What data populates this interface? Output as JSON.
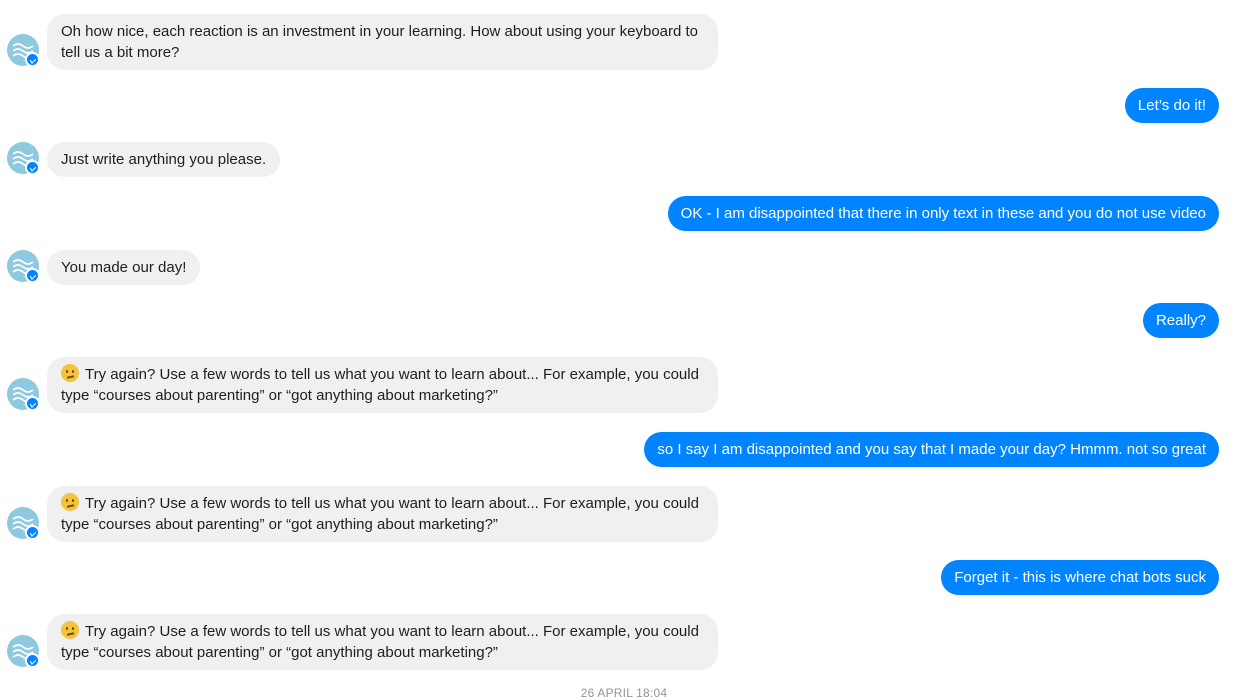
{
  "messages": [
    {
      "from": "bot",
      "text": "Oh how nice, each reaction is an investment in your learning. How about using your keyboard to tell us a bit more?"
    },
    {
      "from": "user",
      "text": "Let’s do it!"
    },
    {
      "from": "bot",
      "text": "Just write anything you please."
    },
    {
      "from": "user",
      "text": "OK - I am disappointed that there in only text in these and you do not use video"
    },
    {
      "from": "bot",
      "text": "You made our day!"
    },
    {
      "from": "user",
      "text": "Really?"
    },
    {
      "from": "bot",
      "emoji": "confused-face",
      "text": "Try again? Use a few words to tell us what you want to learn about... For example, you could type “courses about parenting” or “got anything about marketing?”"
    },
    {
      "from": "user",
      "text": "so I say I am disappointed and you say that I made your day?  Hmmm. not so great"
    },
    {
      "from": "bot",
      "emoji": "confused-face",
      "text": "Try again? Use a few words to tell us what you want to learn about... For example, you could type “courses about parenting” or “got anything about marketing?”"
    },
    {
      "from": "user",
      "text": "Forget it - this is where chat bots suck"
    },
    {
      "from": "bot",
      "emoji": "confused-face",
      "text": "Try again? Use a few words to tell us what you want to learn about... For example, you could type “courses about parenting” or “got anything about marketing?”"
    }
  ],
  "timestamp": "26 APRIL 18:04",
  "colors": {
    "incoming_bubble": "#f1f0f0",
    "outgoing_bubble": "#0084ff",
    "avatar": "#8ec9df",
    "timestamp_text": "#90949c"
  }
}
